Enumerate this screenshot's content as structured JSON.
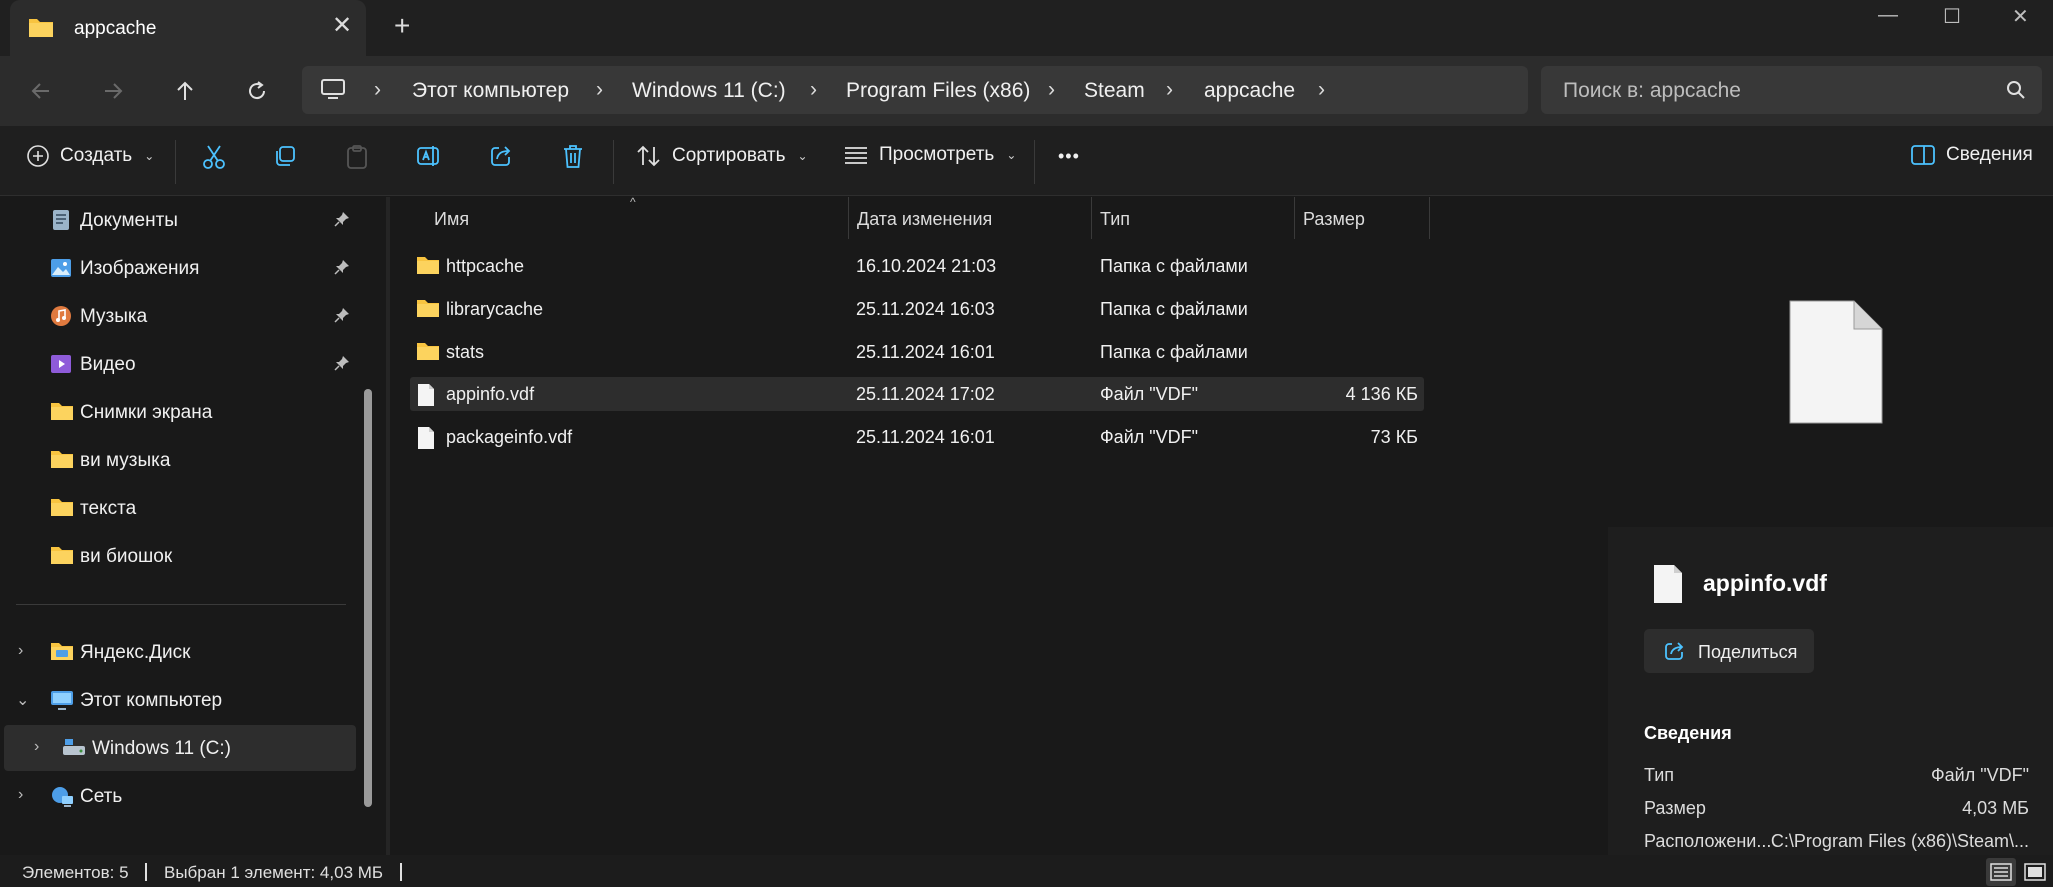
{
  "tab": {
    "title": "appcache",
    "close_glyph": "✕",
    "new_glyph": "+"
  },
  "window": {
    "minimize": "—",
    "maximize": "☐",
    "close": "✕"
  },
  "address": {
    "segments": [
      "Этот компьютер",
      "Windows 11 (C:)",
      "Program Files (x86)",
      "Steam",
      "appcache"
    ],
    "chevron": "›"
  },
  "search": {
    "placeholder": "Поиск в: appcache"
  },
  "toolbar": {
    "create": "Создать",
    "sort": "Сортировать",
    "view": "Просмотреть",
    "more": "•••",
    "details": "Сведения"
  },
  "sidebar": {
    "pinned": [
      {
        "label": "Документы",
        "icon": "documents-icon"
      },
      {
        "label": "Изображения",
        "icon": "pictures-icon"
      },
      {
        "label": "Музыка",
        "icon": "music-icon"
      },
      {
        "label": "Видео",
        "icon": "video-icon"
      }
    ],
    "folders": [
      "Снимки экрана",
      "ви музыка",
      "текста",
      "ви биошок"
    ],
    "tree": [
      {
        "label": "Яндекс.Диск",
        "expander": "›"
      },
      {
        "label": "Этот компьютер",
        "expander": "⌄"
      },
      {
        "label": "Windows 11 (C:)",
        "expander": "›"
      },
      {
        "label": "Сеть",
        "expander": "›"
      }
    ]
  },
  "columns": {
    "name": "Имя",
    "date": "Дата изменения",
    "type": "Тип",
    "size": "Размер",
    "sort_glyph": "^"
  },
  "files": [
    {
      "name": "httpcache",
      "date": "16.10.2024 21:03",
      "type": "Папка с файлами",
      "size": "",
      "kind": "folder"
    },
    {
      "name": "librarycache",
      "date": "25.11.2024 16:03",
      "type": "Папка с файлами",
      "size": "",
      "kind": "folder"
    },
    {
      "name": "stats",
      "date": "25.11.2024 16:01",
      "type": "Папка с файлами",
      "size": "",
      "kind": "folder"
    },
    {
      "name": "appinfo.vdf",
      "date": "25.11.2024 17:02",
      "type": "Файл \"VDF\"",
      "size": "4 136 КБ",
      "kind": "file"
    },
    {
      "name": "packageinfo.vdf",
      "date": "25.11.2024 16:01",
      "type": "Файл \"VDF\"",
      "size": "73 КБ",
      "kind": "file"
    }
  ],
  "details": {
    "name": "appinfo.vdf",
    "share": "Поделиться",
    "heading": "Сведения",
    "props": [
      {
        "k": "Тип",
        "v": "Файл \"VDF\""
      },
      {
        "k": "Размер",
        "v": "4,03 МБ"
      },
      {
        "k": "Расположени...",
        "v": "C:\\Program Files (x86)\\Steam\\..."
      }
    ]
  },
  "status": {
    "count": "Элементов: 5",
    "selected": "Выбран 1 элемент: 4,03 МБ"
  },
  "colors": {
    "accent": "#4cc2ff",
    "folder": "#f8c440",
    "bg": "#191919"
  }
}
